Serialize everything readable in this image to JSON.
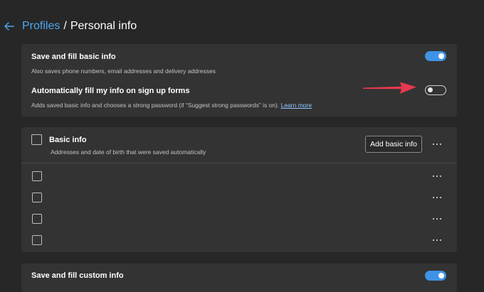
{
  "breadcrumb": {
    "parent": "Profiles",
    "separator": "/",
    "current": "Personal info",
    "back_icon": "arrow-left-icon"
  },
  "basic_settings": {
    "save_fill": {
      "title": "Save and fill basic info",
      "description": "Also saves phone numbers, email addresses and delivery addresses",
      "enabled": true
    },
    "auto_fill_signup": {
      "title": "Automatically fill my info on sign up forms",
      "description": "Adds saved basic info and chooses a strong password (if “Suggest strong passwords” is on).",
      "learn_more": "Learn more",
      "enabled": false
    }
  },
  "basic_info": {
    "title": "Basic info",
    "description": "Addresses and date of birth that were saved automatically",
    "add_button": "Add basic info",
    "entries_count": 4
  },
  "custom_info": {
    "title": "Save and fill custom info",
    "enabled": true
  },
  "colors": {
    "background": "#272727",
    "card": "#333333",
    "accent": "#3f93e6",
    "link": "#4ea7f0",
    "annotation_arrow": "#e8384f"
  }
}
